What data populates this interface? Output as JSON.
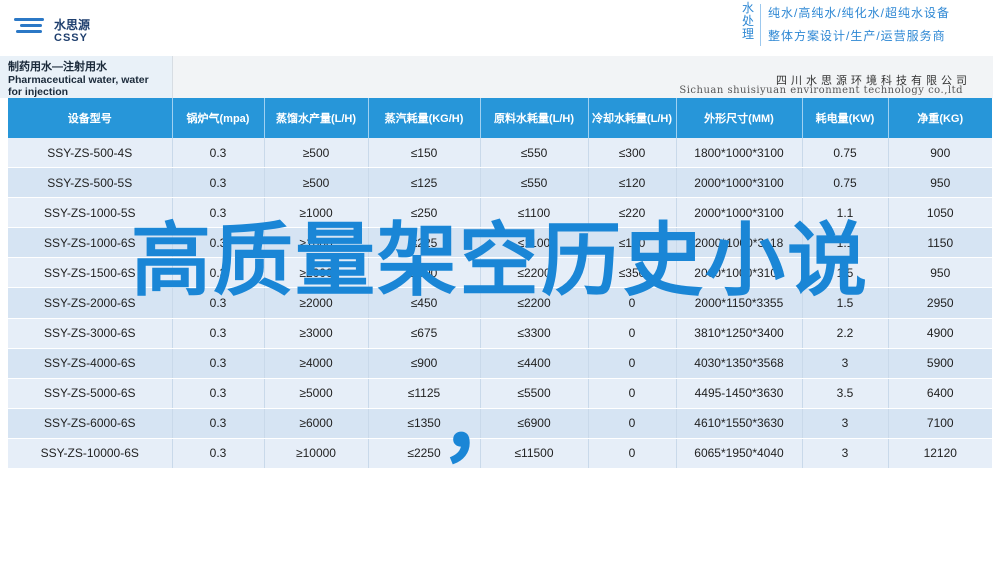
{
  "brand": {
    "logo_cn": "水思源",
    "logo_en": "CSSY",
    "vertical": "水处理",
    "slogan_line1": "纯水/高纯水/纯化水/超纯水设备",
    "slogan_line2": "整体方案设计/生产/运营服务商"
  },
  "doc": {
    "title_cn": "制药用水—注射用水",
    "title_en": "Pharmaceutical water, water for injection",
    "company_cn": "四川水思源环境科技有限公司",
    "company_en": "Sichuan shuisiyuan environment technology co.,ltd"
  },
  "table": {
    "headers": [
      "设备型号",
      "锅炉气(mpa)",
      "蒸馏水产量(L/H)",
      "蒸汽耗量(KG/H)",
      "原料水耗量(L/H)",
      "冷却水耗量(L/H)",
      "外形尺寸(MM)",
      "耗电量(KW)",
      "净重(KG)"
    ],
    "rows": [
      [
        "SSY-ZS-500-4S",
        "0.3",
        "≥500",
        "≤150",
        "≤550",
        "≤300",
        "1800*1000*3100",
        "0.75",
        "900"
      ],
      [
        "SSY-ZS-500-5S",
        "0.3",
        "≥500",
        "≤125",
        "≤550",
        "≤120",
        "2000*1000*3100",
        "0.75",
        "950"
      ],
      [
        "SSY-ZS-1000-5S",
        "0.3",
        "≥1000",
        "≤250",
        "≤1100",
        "≤220",
        "2000*1000*3100",
        "1.1",
        "1050"
      ],
      [
        "SSY-ZS-1000-6S",
        "0.3",
        "≥1000",
        "≤225",
        "≤1100",
        "≤100",
        "2000*1000*3118",
        "1.1",
        "1150"
      ],
      [
        "SSY-ZS-1500-6S",
        "0.3",
        "≥2000",
        "≤500",
        "≤2200",
        "≤350",
        "2000*1000*3100",
        "1.5",
        "950"
      ],
      [
        "SSY-ZS-2000-6S",
        "0.3",
        "≥2000",
        "≤450",
        "≤2200",
        "0",
        "2000*1150*3355",
        "1.5",
        "2950"
      ],
      [
        "SSY-ZS-3000-6S",
        "0.3",
        "≥3000",
        "≤675",
        "≤3300",
        "0",
        "3810*1250*3400",
        "2.2",
        "4900"
      ],
      [
        "SSY-ZS-4000-6S",
        "0.3",
        "≥4000",
        "≤900",
        "≤4400",
        "0",
        "4030*1350*3568",
        "3",
        "5900"
      ],
      [
        "SSY-ZS-5000-6S",
        "0.3",
        "≥5000",
        "≤1125",
        "≤5500",
        "0",
        "4495-1450*3630",
        "3.5",
        "6400"
      ],
      [
        "SSY-ZS-6000-6S",
        "0.3",
        "≥6000",
        "≤1350",
        "≤6900",
        "0",
        "4610*1550*3630",
        "3",
        "7100"
      ],
      [
        "SSY-ZS-10000-6S",
        "0.3",
        "≥10000",
        "≤2250",
        "≤11500",
        "0",
        "6065*1950*4040",
        "3",
        "12120"
      ]
    ]
  },
  "overlay": {
    "text": "高质量架空历史小说",
    "comma": "，"
  },
  "colors": {
    "header_blue": "#2796d9",
    "overlay_blue": "#1a86d6",
    "row_light": "#e6eef8",
    "row_dark": "#d6e4f3"
  }
}
